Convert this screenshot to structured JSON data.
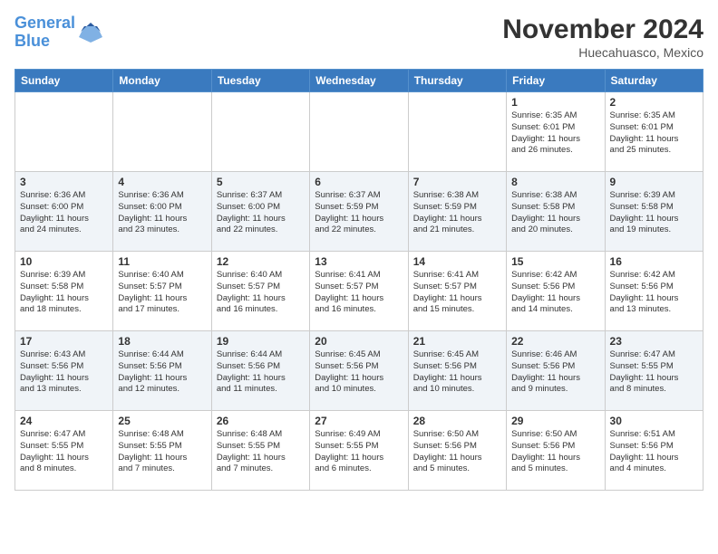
{
  "header": {
    "logo_line1": "General",
    "logo_line2": "Blue",
    "month_title": "November 2024",
    "location": "Huecahuasco, Mexico"
  },
  "days_of_week": [
    "Sunday",
    "Monday",
    "Tuesday",
    "Wednesday",
    "Thursday",
    "Friday",
    "Saturday"
  ],
  "weeks": [
    [
      {
        "num": "",
        "text": ""
      },
      {
        "num": "",
        "text": ""
      },
      {
        "num": "",
        "text": ""
      },
      {
        "num": "",
        "text": ""
      },
      {
        "num": "",
        "text": ""
      },
      {
        "num": "1",
        "text": "Sunrise: 6:35 AM\nSunset: 6:01 PM\nDaylight: 11 hours\nand 26 minutes."
      },
      {
        "num": "2",
        "text": "Sunrise: 6:35 AM\nSunset: 6:01 PM\nDaylight: 11 hours\nand 25 minutes."
      }
    ],
    [
      {
        "num": "3",
        "text": "Sunrise: 6:36 AM\nSunset: 6:00 PM\nDaylight: 11 hours\nand 24 minutes."
      },
      {
        "num": "4",
        "text": "Sunrise: 6:36 AM\nSunset: 6:00 PM\nDaylight: 11 hours\nand 23 minutes."
      },
      {
        "num": "5",
        "text": "Sunrise: 6:37 AM\nSunset: 6:00 PM\nDaylight: 11 hours\nand 22 minutes."
      },
      {
        "num": "6",
        "text": "Sunrise: 6:37 AM\nSunset: 5:59 PM\nDaylight: 11 hours\nand 22 minutes."
      },
      {
        "num": "7",
        "text": "Sunrise: 6:38 AM\nSunset: 5:59 PM\nDaylight: 11 hours\nand 21 minutes."
      },
      {
        "num": "8",
        "text": "Sunrise: 6:38 AM\nSunset: 5:58 PM\nDaylight: 11 hours\nand 20 minutes."
      },
      {
        "num": "9",
        "text": "Sunrise: 6:39 AM\nSunset: 5:58 PM\nDaylight: 11 hours\nand 19 minutes."
      }
    ],
    [
      {
        "num": "10",
        "text": "Sunrise: 6:39 AM\nSunset: 5:58 PM\nDaylight: 11 hours\nand 18 minutes."
      },
      {
        "num": "11",
        "text": "Sunrise: 6:40 AM\nSunset: 5:57 PM\nDaylight: 11 hours\nand 17 minutes."
      },
      {
        "num": "12",
        "text": "Sunrise: 6:40 AM\nSunset: 5:57 PM\nDaylight: 11 hours\nand 16 minutes."
      },
      {
        "num": "13",
        "text": "Sunrise: 6:41 AM\nSunset: 5:57 PM\nDaylight: 11 hours\nand 16 minutes."
      },
      {
        "num": "14",
        "text": "Sunrise: 6:41 AM\nSunset: 5:57 PM\nDaylight: 11 hours\nand 15 minutes."
      },
      {
        "num": "15",
        "text": "Sunrise: 6:42 AM\nSunset: 5:56 PM\nDaylight: 11 hours\nand 14 minutes."
      },
      {
        "num": "16",
        "text": "Sunrise: 6:42 AM\nSunset: 5:56 PM\nDaylight: 11 hours\nand 13 minutes."
      }
    ],
    [
      {
        "num": "17",
        "text": "Sunrise: 6:43 AM\nSunset: 5:56 PM\nDaylight: 11 hours\nand 13 minutes."
      },
      {
        "num": "18",
        "text": "Sunrise: 6:44 AM\nSunset: 5:56 PM\nDaylight: 11 hours\nand 12 minutes."
      },
      {
        "num": "19",
        "text": "Sunrise: 6:44 AM\nSunset: 5:56 PM\nDaylight: 11 hours\nand 11 minutes."
      },
      {
        "num": "20",
        "text": "Sunrise: 6:45 AM\nSunset: 5:56 PM\nDaylight: 11 hours\nand 10 minutes."
      },
      {
        "num": "21",
        "text": "Sunrise: 6:45 AM\nSunset: 5:56 PM\nDaylight: 11 hours\nand 10 minutes."
      },
      {
        "num": "22",
        "text": "Sunrise: 6:46 AM\nSunset: 5:56 PM\nDaylight: 11 hours\nand 9 minutes."
      },
      {
        "num": "23",
        "text": "Sunrise: 6:47 AM\nSunset: 5:55 PM\nDaylight: 11 hours\nand 8 minutes."
      }
    ],
    [
      {
        "num": "24",
        "text": "Sunrise: 6:47 AM\nSunset: 5:55 PM\nDaylight: 11 hours\nand 8 minutes."
      },
      {
        "num": "25",
        "text": "Sunrise: 6:48 AM\nSunset: 5:55 PM\nDaylight: 11 hours\nand 7 minutes."
      },
      {
        "num": "26",
        "text": "Sunrise: 6:48 AM\nSunset: 5:55 PM\nDaylight: 11 hours\nand 7 minutes."
      },
      {
        "num": "27",
        "text": "Sunrise: 6:49 AM\nSunset: 5:55 PM\nDaylight: 11 hours\nand 6 minutes."
      },
      {
        "num": "28",
        "text": "Sunrise: 6:50 AM\nSunset: 5:56 PM\nDaylight: 11 hours\nand 5 minutes."
      },
      {
        "num": "29",
        "text": "Sunrise: 6:50 AM\nSunset: 5:56 PM\nDaylight: 11 hours\nand 5 minutes."
      },
      {
        "num": "30",
        "text": "Sunrise: 6:51 AM\nSunset: 5:56 PM\nDaylight: 11 hours\nand 4 minutes."
      }
    ]
  ]
}
